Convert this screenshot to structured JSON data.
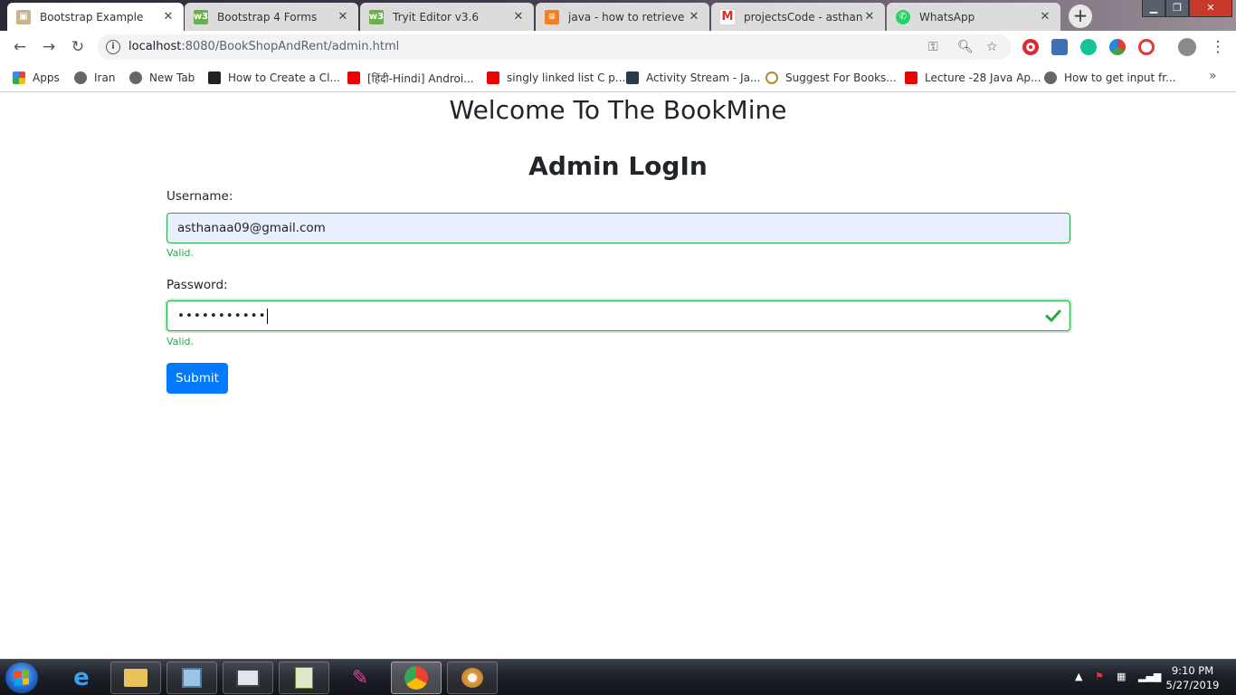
{
  "browser": {
    "tabs": [
      {
        "title": "Bootstrap Example",
        "active": true
      },
      {
        "title": "Bootstrap 4 Forms",
        "active": false
      },
      {
        "title": "Tryit Editor v3.6",
        "active": false
      },
      {
        "title": "java - how to retrieve da",
        "active": false
      },
      {
        "title": "projectsCode - asthanaa",
        "active": false
      },
      {
        "title": "WhatsApp",
        "active": false
      }
    ],
    "address": {
      "host": "localhost",
      "rest": ":8080/BookShopAndRent/admin.html"
    },
    "bookmarks": [
      "Apps",
      "Iran",
      "New Tab",
      "How to Create a Cl...",
      "[हिंदी-Hindi] Androi...",
      "singly linked list C p...",
      "Activity Stream - Ja...",
      "Suggest For Books...",
      "Lecture -28 Java Ap...",
      "How to get input fr..."
    ]
  },
  "page": {
    "heading": "Welcome To The BookMine",
    "subheading": "Admin LogIn",
    "username": {
      "label": "Username:",
      "value": "asthanaa09@gmail.com",
      "feedback": "Valid."
    },
    "password": {
      "label": "Password:",
      "masked_value": "•••••••••••",
      "feedback": "Valid."
    },
    "submit_label": "Submit"
  },
  "taskbar": {
    "time": "9:10 PM",
    "date": "5/27/2019"
  },
  "colors": {
    "valid_green": "#28a745",
    "primary_blue": "#007bff",
    "autofill_bg": "#e8f0fe"
  }
}
